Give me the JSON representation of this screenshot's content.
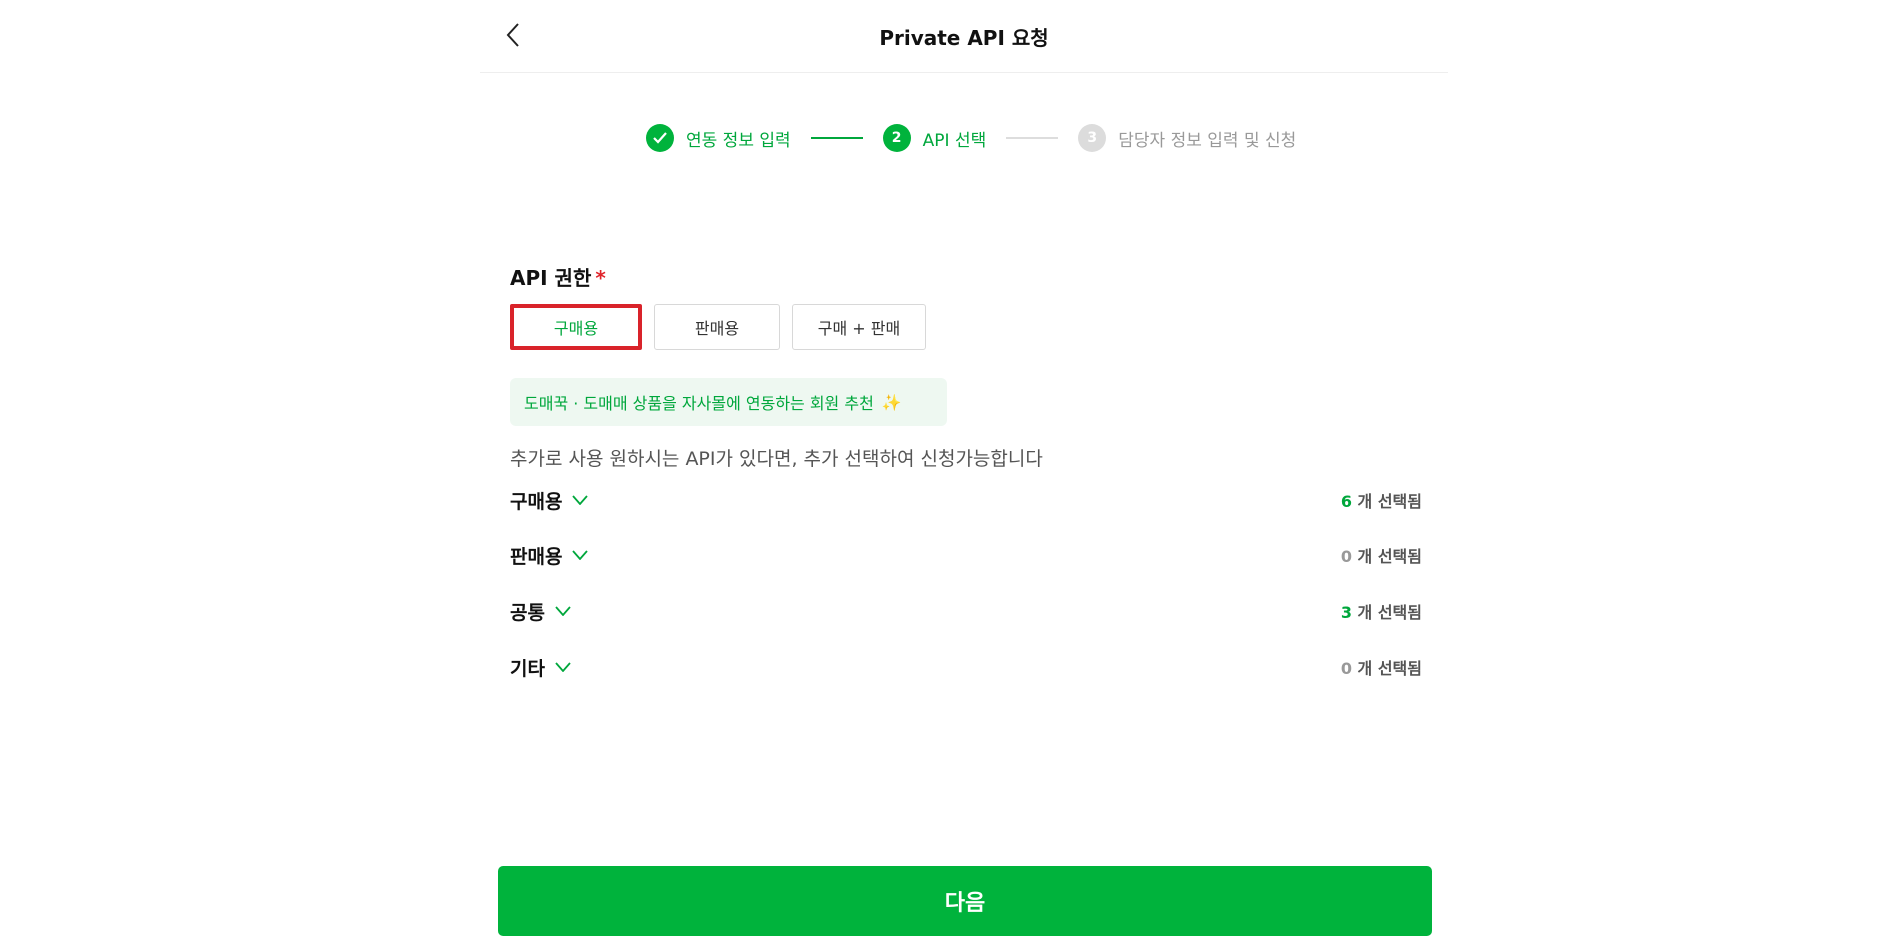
{
  "header": {
    "title": "Private API 요청",
    "back_icon": "chevron-left-icon"
  },
  "stepper": {
    "steps": [
      {
        "num": "✓",
        "label": "연동 정보 입력",
        "state": "done"
      },
      {
        "num": "2",
        "label": "API 선택",
        "state": "active"
      },
      {
        "num": "3",
        "label": "담당자 정보 입력 및 신청",
        "state": "pending"
      }
    ]
  },
  "permission": {
    "title": "API 권한",
    "required_mark": "*",
    "options": [
      {
        "label": "구매용",
        "selected": true
      },
      {
        "label": "판매용",
        "selected": false
      },
      {
        "label": "구매 + 판매",
        "selected": false
      }
    ],
    "recommendation": "도매꾹 · 도매매 상품을 자사몰에 연동하는 회원 추천",
    "sparkle": "✨"
  },
  "description": "추가로 사용 원하시는 API가 있다면, 추가 선택하여 신청가능합니다",
  "categories": [
    {
      "name": "구매용",
      "count": "6",
      "suffix": "개 선택됨"
    },
    {
      "name": "판매용",
      "count": "0",
      "suffix": "개 선택됨"
    },
    {
      "name": "공통",
      "count": "3",
      "suffix": "개 선택됨"
    },
    {
      "name": "기타",
      "count": "0",
      "suffix": "개 선택됨"
    }
  ],
  "next_button": {
    "label": "다음"
  },
  "colors": {
    "accent": "#00b33c",
    "accent_text": "#00a73c",
    "highlight_border": "#d9232a"
  }
}
